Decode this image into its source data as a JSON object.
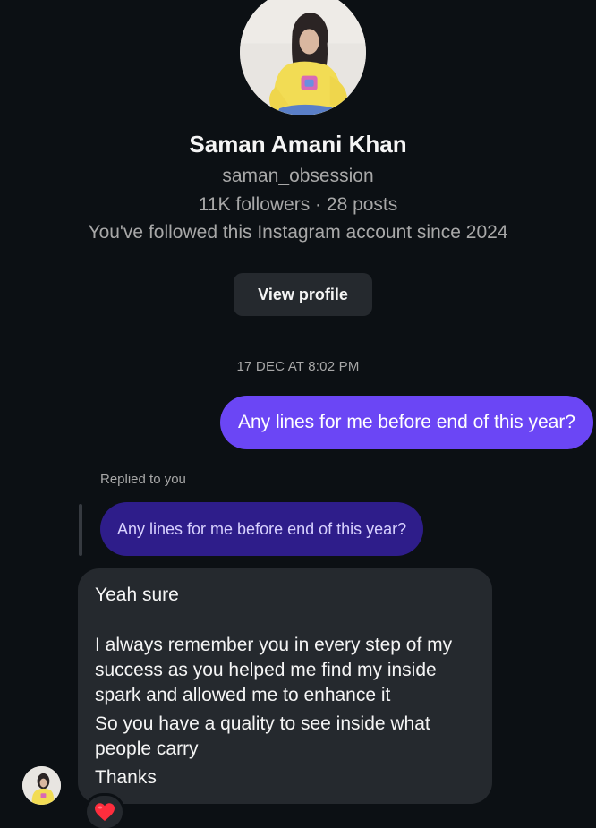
{
  "profile": {
    "name": "Saman Amani Khan",
    "handle": "saman_obsession",
    "stats": "11K followers · 28 posts",
    "followed_note": "You've followed this Instagram account since 2024",
    "view_profile_label": "View profile",
    "avatar_icon": "profile-photo"
  },
  "thread": {
    "timestamp": "17 DEC AT 8:02 PM",
    "sent_message": "Any lines for me before end of this year?",
    "reply_context": {
      "label": "Replied to you",
      "quoted_text": "Any lines for me before end of this year?"
    },
    "received_message": {
      "line1": "Yeah sure",
      "para1": "I always remember you in every step of my success as you helped me find my inside spark and allowed me to enhance it",
      "para2": "So you have a quality to see inside what people carry",
      "para3": "Thanks"
    },
    "reaction": "heart-emoji"
  },
  "colors": {
    "background": "#0c1014",
    "sent_bubble": "#6b46f5",
    "quoted_bubble": "#2e1d8a",
    "received_bubble": "#25292e",
    "secondary_text": "#a8a8a8"
  }
}
